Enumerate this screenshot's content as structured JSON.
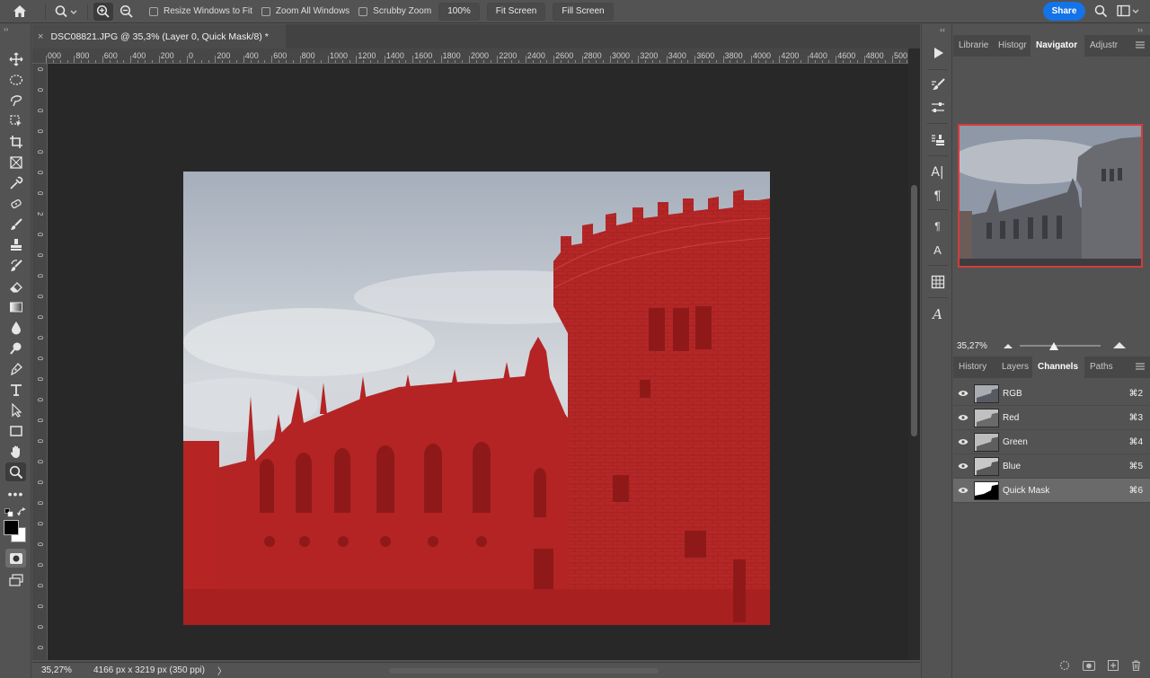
{
  "options_bar": {
    "home_icon": "home-icon",
    "zoom_tool_icon": "magnifier-icon",
    "zoom_in_icon": "zoom-in-icon",
    "zoom_out_icon": "zoom-out-icon",
    "resize_windows_label": "Resize Windows to Fit",
    "zoom_all_label": "Zoom All Windows",
    "scrubby_zoom_label": "Scrubby Zoom",
    "zoom_value": "100%",
    "fit_screen_label": "Fit Screen",
    "fill_screen_label": "Fill Screen",
    "share_label": "Share",
    "accent_color": "#1473e6"
  },
  "document": {
    "tab_title": "DSC08821.JPG @ 35,3% (Layer 0, Quick Mask/8) *",
    "close_glyph": "×"
  },
  "ruler": {
    "h_labels": [
      "000",
      "800",
      "600",
      "400",
      "200",
      "0",
      "200",
      "400",
      "600",
      "800",
      "1000",
      "1200",
      "1400",
      "1600",
      "1800",
      "2000",
      "2200",
      "2400",
      "2600",
      "2800",
      "3000",
      "3200",
      "3400",
      "3600",
      "3800",
      "4000",
      "4200",
      "4400",
      "4600",
      "4800",
      "500"
    ],
    "v_labels": [
      "0",
      "0",
      "0",
      "0",
      "0",
      "0",
      "0",
      "2",
      "0",
      "0",
      "0",
      "0",
      "0",
      "0",
      "0",
      "0",
      "0",
      "0",
      "0",
      "0",
      "0",
      "0",
      "0",
      "0",
      "0",
      "0",
      "0",
      "0",
      "0"
    ]
  },
  "status": {
    "zoom": "35,27%",
    "dimensions": "4166 px x 3219 px (350 ppi)",
    "arrow": "〉"
  },
  "quick_mask_color": "#b82020",
  "navigator": {
    "tabs": [
      "Librarie",
      "Histogr",
      "Navigator",
      "Adjustr"
    ],
    "active_tab": "Navigator",
    "zoom": "35,27%"
  },
  "channels_panel": {
    "tabs": [
      "History",
      "Layers",
      "Channels",
      "Paths"
    ],
    "active_tab": "Channels",
    "rows": [
      {
        "name": "RGB",
        "key": "⌘2"
      },
      {
        "name": "Red",
        "key": "⌘3"
      },
      {
        "name": "Green",
        "key": "⌘4"
      },
      {
        "name": "Blue",
        "key": "⌘5"
      },
      {
        "name": "Quick Mask",
        "key": "⌘6"
      }
    ],
    "selected": "Quick Mask"
  }
}
